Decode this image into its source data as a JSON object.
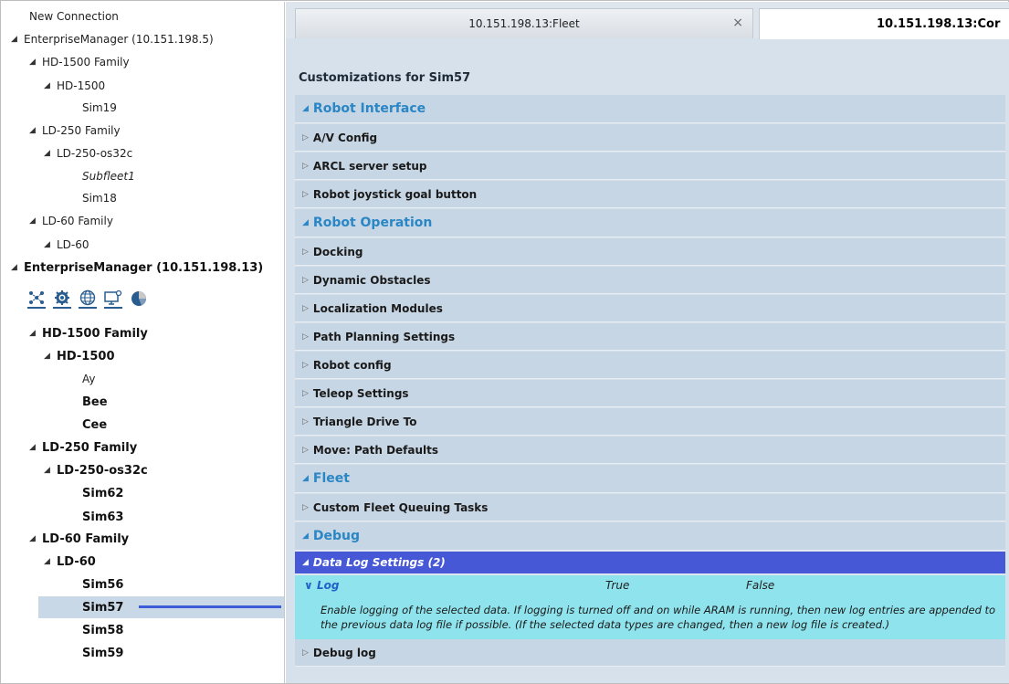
{
  "tree": {
    "items": [
      {
        "label": "New Connection",
        "tri": "",
        "level": 0,
        "style": ""
      },
      {
        "label": "EnterpriseManager (10.151.198.5)",
        "tri": "◢",
        "level": 0,
        "style": ""
      },
      {
        "label": "HD-1500 Family",
        "tri": "◢",
        "level": 1,
        "style": ""
      },
      {
        "label": "HD-1500",
        "tri": "◢",
        "level": 2,
        "style": ""
      },
      {
        "label": "Sim19",
        "tri": "",
        "level": 3,
        "style": ""
      },
      {
        "label": "LD-250 Family",
        "tri": "◢",
        "level": 1,
        "style": ""
      },
      {
        "label": "LD-250-os32c",
        "tri": "◢",
        "level": 2,
        "style": ""
      },
      {
        "label": "Subfleet1",
        "tri": "",
        "level": 3,
        "style": "i"
      },
      {
        "label": "Sim18",
        "tri": "",
        "level": 3,
        "style": ""
      },
      {
        "label": "LD-60 Family",
        "tri": "◢",
        "level": 1,
        "style": ""
      },
      {
        "label": "LD-60",
        "tri": "◢",
        "level": 2,
        "style": ""
      },
      {
        "label": "EnterpriseManager (10.151.198.13)",
        "tri": "◢",
        "level": 0,
        "style": "b"
      },
      {
        "label": "HD-1500 Family",
        "tri": "◢",
        "level": 1,
        "style": "b"
      },
      {
        "label": "HD-1500",
        "tri": "◢",
        "level": 2,
        "style": "b"
      },
      {
        "label": "Ay",
        "tri": "",
        "level": 3,
        "style": ""
      },
      {
        "label": "Bee",
        "tri": "",
        "level": 3,
        "style": "b"
      },
      {
        "label": "Cee",
        "tri": "",
        "level": 3,
        "style": "b"
      },
      {
        "label": "LD-250 Family",
        "tri": "◢",
        "level": 1,
        "style": "b"
      },
      {
        "label": "LD-250-os32c",
        "tri": "◢",
        "level": 2,
        "style": "b"
      },
      {
        "label": "Sim62",
        "tri": "",
        "level": 3,
        "style": "b"
      },
      {
        "label": "Sim63",
        "tri": "",
        "level": 3,
        "style": "b"
      },
      {
        "label": "LD-60 Family",
        "tri": "◢",
        "level": 1,
        "style": "b"
      },
      {
        "label": "LD-60",
        "tri": "◢",
        "level": 2,
        "style": "b"
      },
      {
        "label": "Sim56",
        "tri": "",
        "level": 3,
        "style": "b"
      },
      {
        "label": "Sim57",
        "tri": "",
        "level": 3,
        "style": "b sel"
      },
      {
        "label": "Sim58",
        "tri": "",
        "level": 3,
        "style": "b"
      },
      {
        "label": "Sim59",
        "tri": "",
        "level": 3,
        "style": "b"
      }
    ],
    "toolbar_icons": [
      "network-icon",
      "settings-gear-icon",
      "globe-icon",
      "monitor-settings-icon",
      "pie-chart-icon"
    ]
  },
  "tabs": {
    "tab1_label": "10.151.198.13:Fleet",
    "tab1_close": "×",
    "tab2_label": "10.151.198.13:Cor"
  },
  "main": {
    "title": "Customizations for Sim57",
    "sections": [
      {
        "kind": "hdr",
        "label": "Robot Interface"
      },
      {
        "kind": "item",
        "label": "A/V Config"
      },
      {
        "kind": "item",
        "label": "ARCL server setup"
      },
      {
        "kind": "item",
        "label": "Robot joystick goal button"
      },
      {
        "kind": "hdr",
        "label": "Robot Operation"
      },
      {
        "kind": "item",
        "label": "Docking"
      },
      {
        "kind": "item",
        "label": "Dynamic Obstacles"
      },
      {
        "kind": "item",
        "label": "Localization Modules"
      },
      {
        "kind": "item",
        "label": "Path Planning Settings"
      },
      {
        "kind": "item",
        "label": "Robot config"
      },
      {
        "kind": "item",
        "label": "Teleop Settings"
      },
      {
        "kind": "item",
        "label": "Triangle Drive To"
      },
      {
        "kind": "item",
        "label": "Move: Path Defaults"
      },
      {
        "kind": "hdr",
        "label": "Fleet"
      },
      {
        "kind": "item",
        "label": "Custom Fleet Queuing Tasks"
      },
      {
        "kind": "hdr",
        "label": "Debug"
      },
      {
        "kind": "active",
        "label": "Data Log Settings (2)"
      },
      {
        "kind": "log",
        "label": "Log"
      },
      {
        "kind": "item",
        "label": "Debug log"
      }
    ],
    "log": {
      "name": "Log",
      "value": "True",
      "default": "False",
      "description": "Enable logging of the selected data. If logging is turned off and on while ARAM is running, then new log entries are appended to the previous data log file if possible. (If the selected data types are changed, then a new log file is created.)"
    },
    "triangles": {
      "expanded": "◢",
      "collapsed": "▷",
      "chevron": "∨"
    }
  }
}
